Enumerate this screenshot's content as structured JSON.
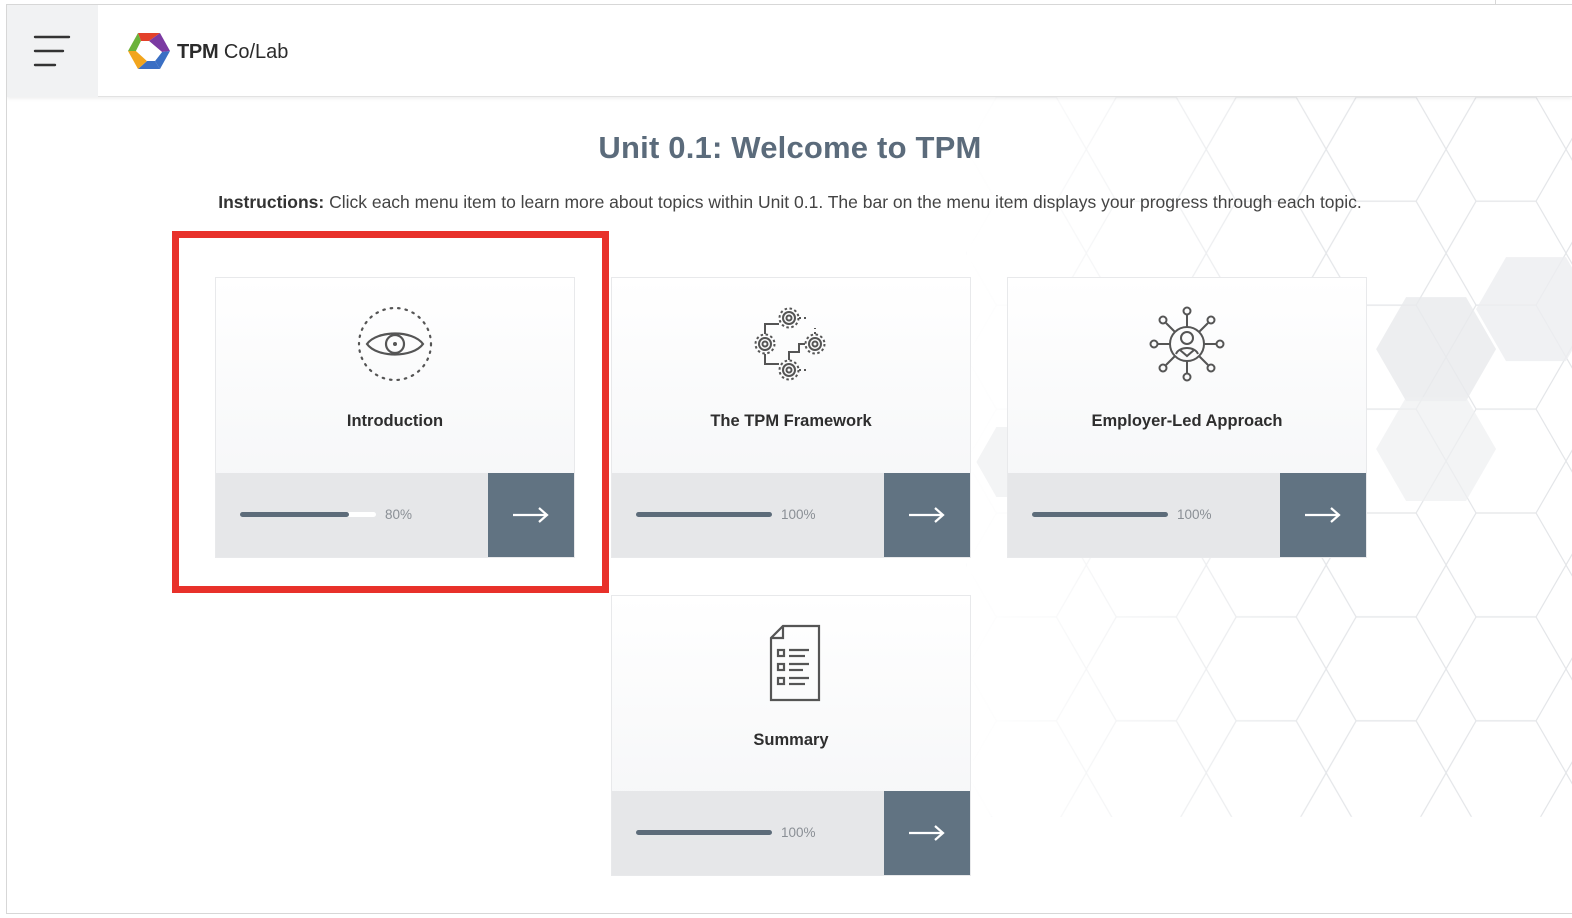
{
  "header": {
    "menu_icon": "hamburger-icon",
    "logo_icon": "hexagon-logo-icon",
    "logo_bold": "TPM",
    "logo_rest": " Co/Lab"
  },
  "main": {
    "title": "Unit 0.1: Welcome to TPM",
    "instructions_bold": "Instructions:",
    "instructions_text": " Click each menu item to learn more about topics within Unit 0.1. The bar on the menu item displays your progress through each topic."
  },
  "cards": [
    {
      "label": "Introduction",
      "icon": "eye-icon",
      "progress": 0.8,
      "progress_label": "80%",
      "button_icon": "arrow-right-icon"
    },
    {
      "label": "The TPM Framework",
      "icon": "gears-network-icon",
      "progress": 1.0,
      "progress_label": "100%",
      "button_icon": "arrow-right-icon"
    },
    {
      "label": "Employer-Led Approach",
      "icon": "person-network-icon",
      "progress": 1.0,
      "progress_label": "100%",
      "button_icon": "arrow-right-icon"
    },
    {
      "label": "Summary",
      "icon": "document-list-icon",
      "progress": 1.0,
      "progress_label": "100%",
      "button_icon": "arrow-right-icon"
    }
  ],
  "colors": {
    "title": "#5b6b7b",
    "button": "#617382",
    "progress": "#5d6c7a",
    "highlight": "#e8312a"
  }
}
